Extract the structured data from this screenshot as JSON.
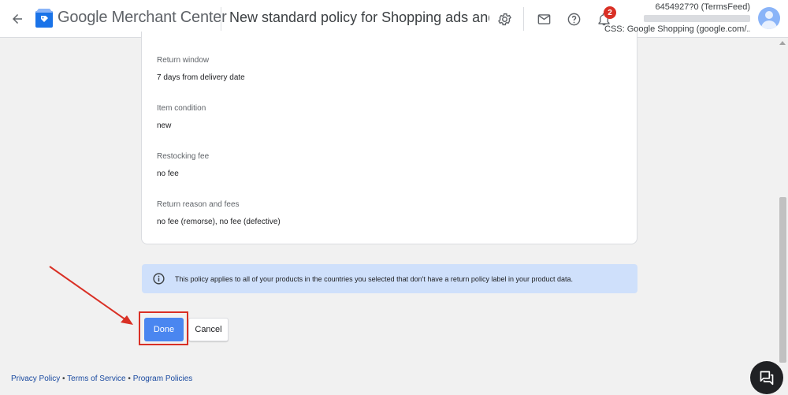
{
  "header": {
    "brand_google": "Google",
    "brand_product": "Merchant Center",
    "page_title": "New standard policy for Shopping ads and ...",
    "notification_count": "2",
    "account_id": "6454927?0 (TermsFeed)",
    "account_css": "CSS: Google Shopping (google.com/..."
  },
  "icons": {
    "back": "arrow-left-icon",
    "settings": "gear-icon",
    "mail": "mail-icon",
    "help": "help-circle-icon",
    "notifications": "bell-icon",
    "info": "info-icon",
    "chat": "chat-icon"
  },
  "policy": {
    "fields": [
      {
        "label": "Return window",
        "value": "7 days from delivery date"
      },
      {
        "label": "Item condition",
        "value": "new"
      },
      {
        "label": "Restocking fee",
        "value": "no fee"
      },
      {
        "label": "Return reason and fees",
        "value": "no fee (remorse), no fee (defective)"
      }
    ]
  },
  "info_banner": {
    "text": "This policy applies to all of your products in the countries you selected that don't have a return policy label in your product data."
  },
  "actions": {
    "done_label": "Done",
    "cancel_label": "Cancel"
  },
  "footer": {
    "links": [
      "Privacy Policy",
      "Terms of Service",
      "Program Policies"
    ],
    "separator": "•"
  },
  "colors": {
    "accent": "#4a86f0",
    "highlight": "#d93025",
    "info_bg": "#cfe0fb",
    "badge": "#d93025"
  }
}
